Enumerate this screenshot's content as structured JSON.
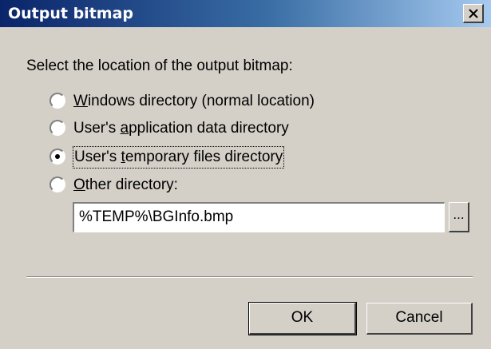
{
  "window": {
    "title": "Output bitmap",
    "close_glyph": "✕"
  },
  "prompt": "Select the location of the output bitmap:",
  "options": [
    {
      "pre": "",
      "mnemonic": "W",
      "post": "indows directory (normal location)",
      "selected": false
    },
    {
      "pre": "User's ",
      "mnemonic": "a",
      "post": "pplication data directory",
      "selected": false
    },
    {
      "pre": "User's ",
      "mnemonic": "t",
      "post": "emporary files directory",
      "selected": true
    },
    {
      "pre": "",
      "mnemonic": "O",
      "post": "ther directory:",
      "selected": false
    }
  ],
  "path_field": {
    "value": "%TEMP%\\BGInfo.bmp"
  },
  "browse_label": "...",
  "buttons": {
    "ok": "OK",
    "cancel": "Cancel"
  },
  "colors": {
    "face": "#d4d0c8",
    "title_start": "#0a246a",
    "title_end": "#a6caf0"
  }
}
